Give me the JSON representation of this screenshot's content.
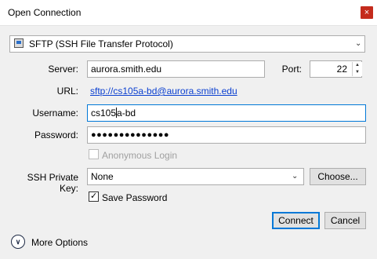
{
  "window": {
    "title": "Open Connection",
    "close_glyph": "×"
  },
  "protocol": {
    "selected": "SFTP (SSH File Transfer Protocol)",
    "icon": "drive-icon"
  },
  "server": {
    "label": "Server:",
    "value": "aurora.smith.edu"
  },
  "port": {
    "label": "Port:",
    "value": "22"
  },
  "url": {
    "label": "URL:",
    "value": "sftp://cs105a-bd@aurora.smith.edu"
  },
  "username": {
    "label": "Username:",
    "value_before_caret": "cs105",
    "value_after_caret": "a-bd"
  },
  "password": {
    "label": "Password:",
    "value": "●●●●●●●●●●●●●●"
  },
  "anonymous": {
    "label": "Anonymous Login",
    "checked": false
  },
  "ssh_key": {
    "label": "SSH Private Key:",
    "selected": "None",
    "choose_label": "Choose..."
  },
  "save_password": {
    "label": "Save Password",
    "checked": true,
    "glyph": "✓"
  },
  "buttons": {
    "connect": "Connect",
    "cancel": "Cancel"
  },
  "more_options": {
    "label": "More Options",
    "icon": "chevron-down-icon"
  },
  "glyphs": {
    "chevron_down": "⌄",
    "spin_up": "▲",
    "spin_down": "▼",
    "more_chevron": "∨"
  },
  "colors": {
    "accent": "#0078d7",
    "link": "#0a3fd0",
    "close": "#c42b1c"
  }
}
